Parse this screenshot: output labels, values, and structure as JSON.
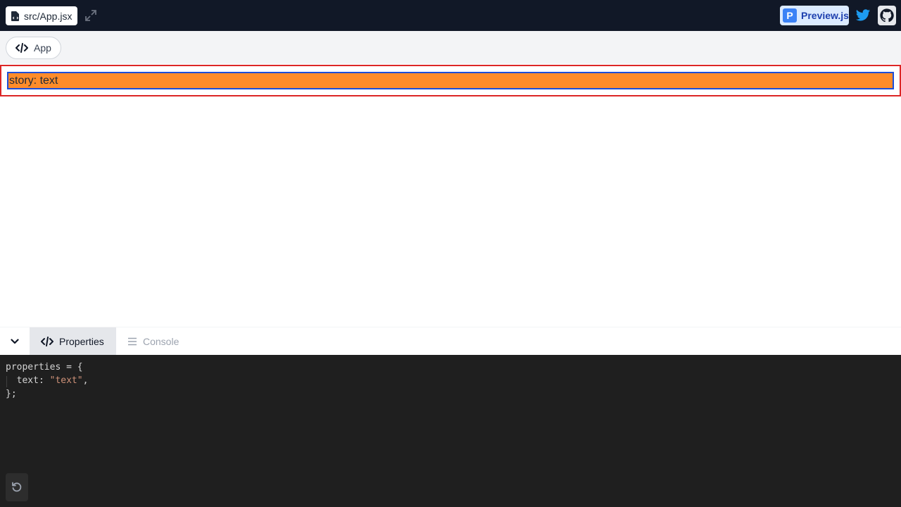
{
  "topbar": {
    "file_name": "src/App.jsx",
    "brand_label": "Preview.js",
    "brand_letter": "P"
  },
  "subbar": {
    "component_label": "App"
  },
  "story": {
    "text": "story: text"
  },
  "panel": {
    "tabs": [
      {
        "label": "Properties",
        "active": true
      },
      {
        "label": "Console",
        "active": false
      }
    ]
  },
  "code": {
    "line1": "properties = {",
    "line2_key": "  text: ",
    "line2_value": "\"text\"",
    "line2_end": ",",
    "line3": "};"
  },
  "colors": {
    "topbar_bg": "#111827",
    "story_bg": "#ff8c2a",
    "story_outer_border": "#dc2626",
    "story_inner_border": "#1d4ed8",
    "code_bg": "#1f1f1f",
    "string_color": "#ce9178",
    "twitter_blue": "#1d9bf0"
  }
}
